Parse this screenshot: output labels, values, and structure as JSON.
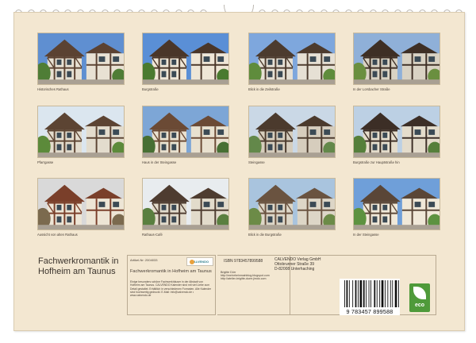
{
  "calendar": {
    "title": "Fachwerkromantik in Hofheim am Taunus",
    "photos": [
      {
        "caption": "Historisches Rathaus"
      },
      {
        "caption": "Burgstraße"
      },
      {
        "caption": "Blick in die Zeilstraße"
      },
      {
        "caption": "In der Lorsbacher Straße"
      },
      {
        "caption": "Pfarrgasse"
      },
      {
        "caption": "Haus in der Steingasse"
      },
      {
        "caption": "Steingasse"
      },
      {
        "caption": "Burgstraße zur Hauptstraße hin"
      },
      {
        "caption": "Aussicht von alten Rathaus"
      },
      {
        "caption": "Rathaus-Café"
      },
      {
        "caption": "Blick in die Burgstraße"
      },
      {
        "caption": "In der Steingasse"
      }
    ]
  },
  "info": {
    "article_label": "Artikel-Nr: 2004033",
    "logo_text": "CALVENDO",
    "product_title": "Fachwerkromantik in Hofheim am Taunus",
    "description": "Einige besonders schöne Fachwerkhäuser in der Altstadt von Hofheim am Taunus. CALVENDO Kalender sind mit viel Liebe zum Detail gestaltet. Erhältlich in verschiedenen Formaten. Alle Kalender sind hochwertig gedruckt. E-Mail: info@calvendo.de • www.calvendo.de",
    "isbn": "ISBN 9783457899588",
    "blog_lines": "Brigitte Dürr\nhttp://meinrheinmainblog.blogspot.com\nhttp://atelier-brigitte-duerr.jimdo.com",
    "publisher": "CALVENDO Verlag GmbH\nOttobrunner Straße 39\nD-82008 Unterhaching",
    "barcode_number": "9 783457 899588",
    "eco_label": "eco"
  }
}
